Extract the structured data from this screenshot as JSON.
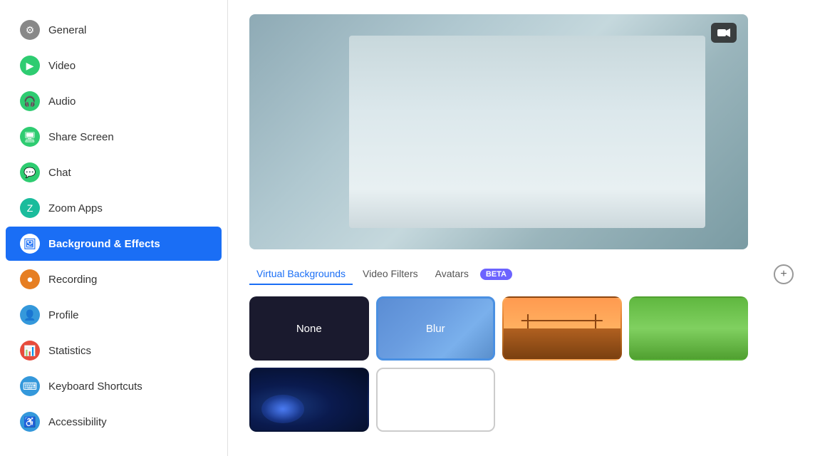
{
  "sidebar": {
    "items": [
      {
        "id": "general",
        "label": "General",
        "icon": "⚙",
        "iconClass": "icon-gray",
        "active": false
      },
      {
        "id": "video",
        "label": "Video",
        "icon": "▶",
        "iconClass": "icon-green",
        "active": false
      },
      {
        "id": "audio",
        "label": "Audio",
        "icon": "🎧",
        "iconClass": "icon-green",
        "active": false
      },
      {
        "id": "share-screen",
        "label": "Share Screen",
        "icon": "🖥",
        "iconClass": "icon-green",
        "active": false
      },
      {
        "id": "chat",
        "label": "Chat",
        "icon": "💬",
        "iconClass": "icon-green",
        "active": false
      },
      {
        "id": "zoom-apps",
        "label": "Zoom Apps",
        "icon": "Z",
        "iconClass": "icon-teal",
        "active": false
      },
      {
        "id": "background-effects",
        "label": "Background & Effects",
        "icon": "🖼",
        "iconClass": "icon-active",
        "active": true
      },
      {
        "id": "recording",
        "label": "Recording",
        "icon": "⏺",
        "iconClass": "icon-orange",
        "active": false
      },
      {
        "id": "profile",
        "label": "Profile",
        "icon": "👤",
        "iconClass": "icon-blue",
        "active": false
      },
      {
        "id": "statistics",
        "label": "Statistics",
        "icon": "📊",
        "iconClass": "icon-red",
        "active": false
      },
      {
        "id": "keyboard-shortcuts",
        "label": "Keyboard Shortcuts",
        "icon": "⌨",
        "iconClass": "icon-blue",
        "active": false
      },
      {
        "id": "accessibility",
        "label": "Accessibility",
        "icon": "♿",
        "iconClass": "icon-blue",
        "active": false
      }
    ]
  },
  "main": {
    "tabs": [
      {
        "id": "virtual-backgrounds",
        "label": "Virtual Backgrounds",
        "active": true
      },
      {
        "id": "video-filters",
        "label": "Video Filters",
        "active": false
      },
      {
        "id": "avatars",
        "label": "Avatars",
        "active": false
      }
    ],
    "beta_label": "BETA",
    "add_button_label": "+",
    "thumbnails": [
      {
        "id": "none",
        "label": "None",
        "type": "none",
        "selected": false
      },
      {
        "id": "blur",
        "label": "Blur",
        "type": "blur",
        "selected": true
      },
      {
        "id": "bridge",
        "label": "Golden Gate Bridge",
        "type": "bridge",
        "selected": false
      },
      {
        "id": "grass",
        "label": "Grass",
        "type": "grass",
        "selected": false
      },
      {
        "id": "space",
        "label": "Space",
        "type": "space",
        "selected": false
      },
      {
        "id": "custom",
        "label": "",
        "type": "white",
        "selected": false
      }
    ],
    "camera_icon": "📷"
  }
}
